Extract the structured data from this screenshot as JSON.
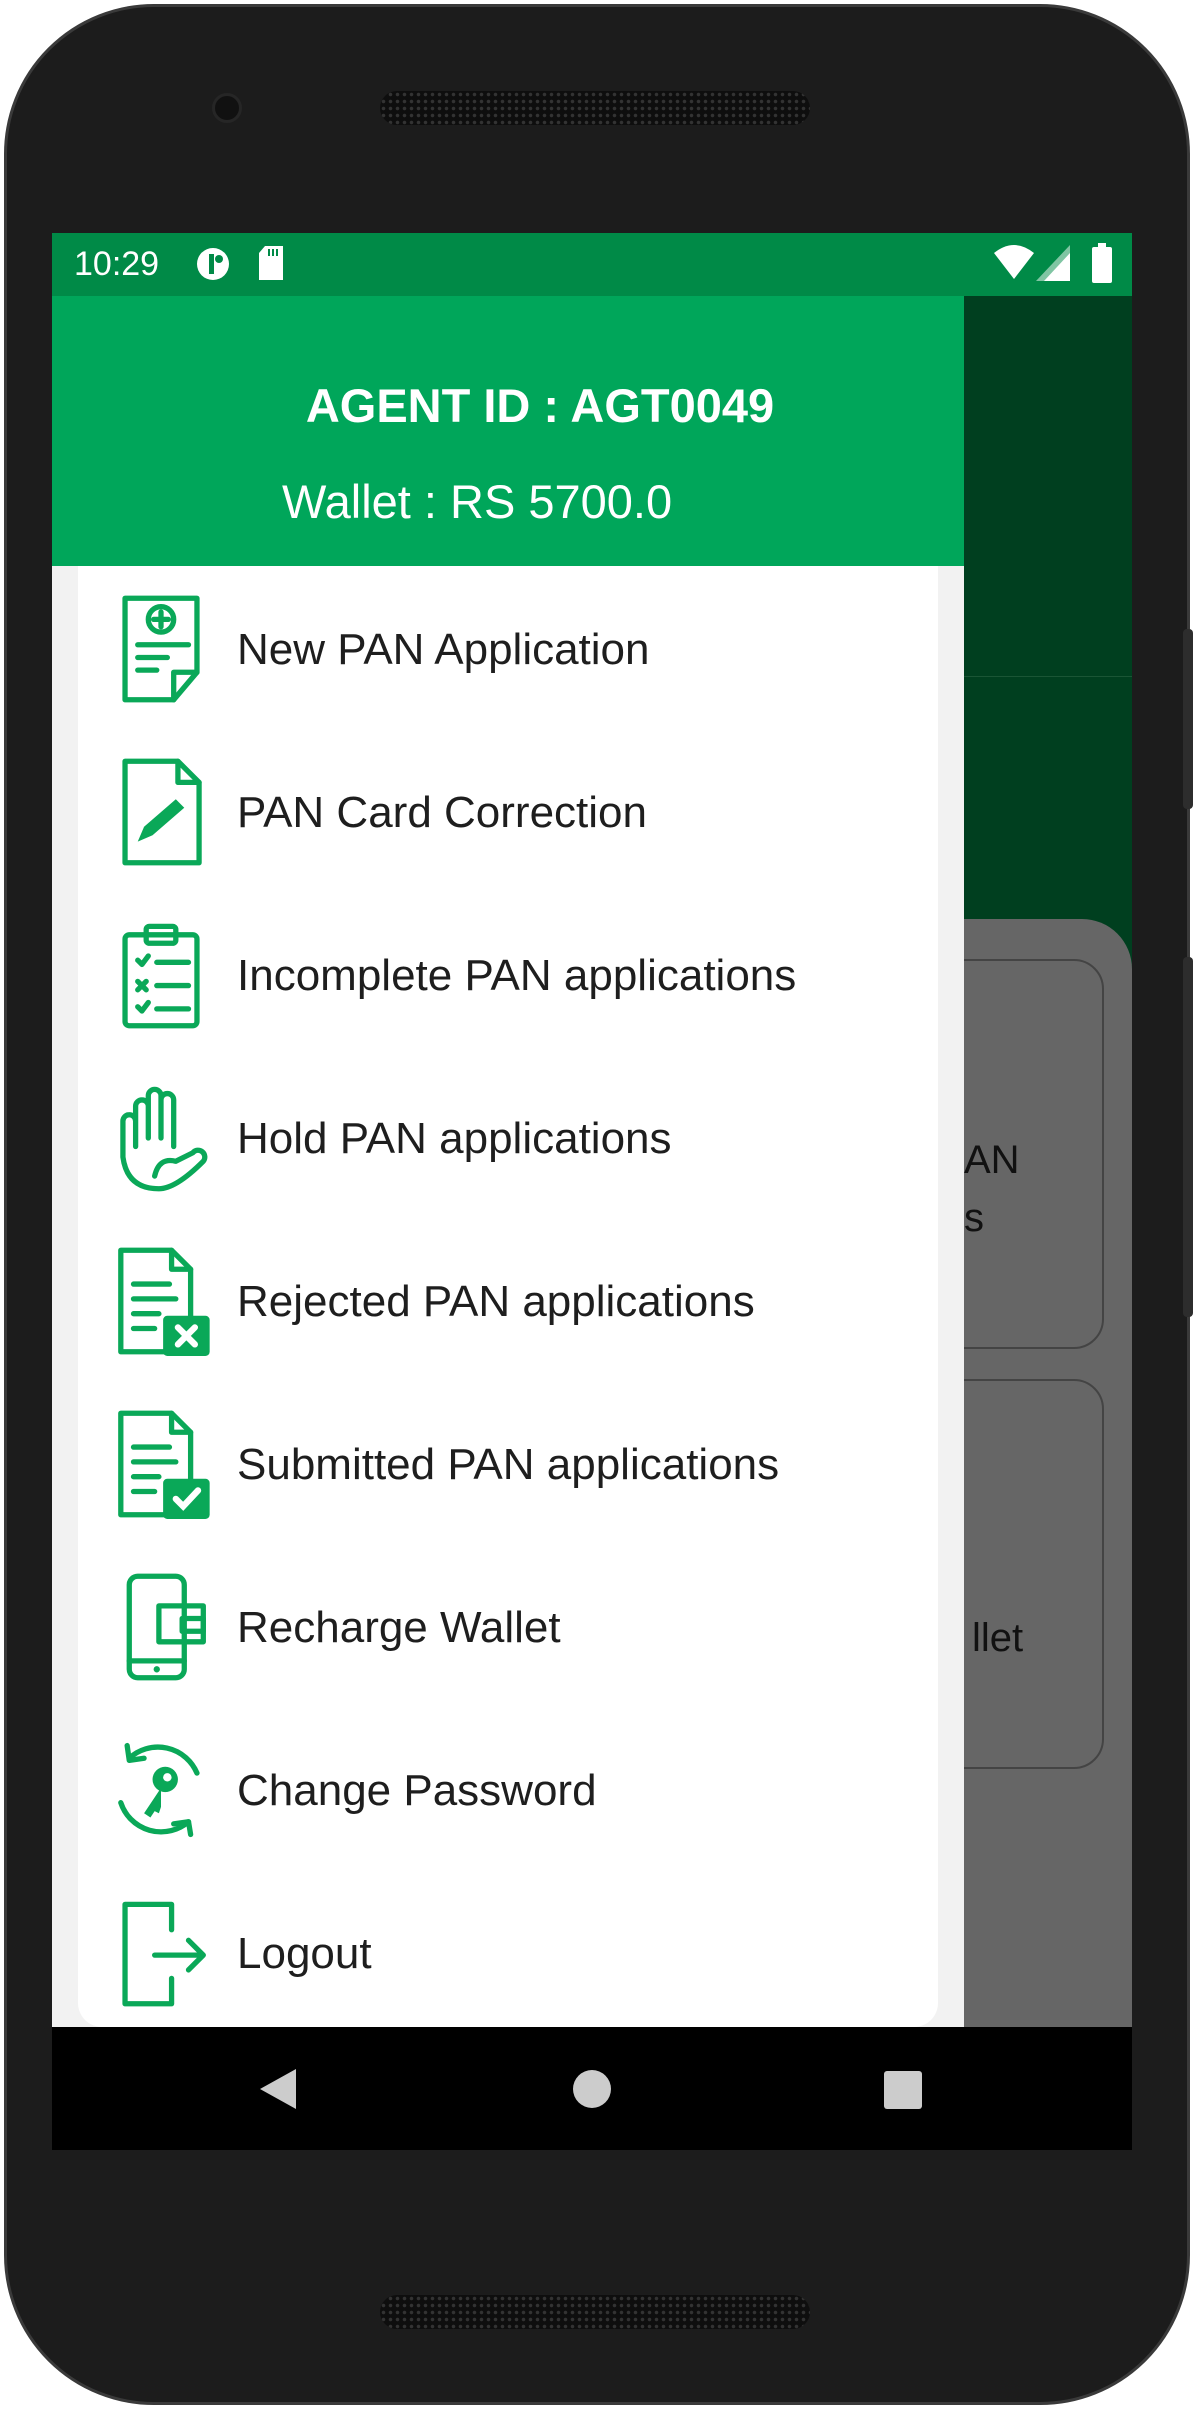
{
  "status_bar": {
    "time": "10:29",
    "icons": [
      "data-saver-icon",
      "sd-card-icon",
      "wifi-icon",
      "signal-icon",
      "battery-icon"
    ]
  },
  "drawer": {
    "agent_id": "AGENT ID : AGT0049",
    "wallet": "Wallet : RS 5700.0",
    "items": [
      {
        "label": "New PAN Application",
        "icon": "new-document-icon"
      },
      {
        "label": "PAN Card Correction",
        "icon": "edit-document-icon"
      },
      {
        "label": "Incomplete PAN applications",
        "icon": "checklist-icon"
      },
      {
        "label": "Hold PAN applications",
        "icon": "hand-icon"
      },
      {
        "label": "Rejected PAN applications",
        "icon": "rejected-document-icon"
      },
      {
        "label": "Submitted PAN applications",
        "icon": "submitted-document-icon"
      },
      {
        "label": "Recharge Wallet",
        "icon": "mobile-wallet-icon"
      },
      {
        "label": "Change Password",
        "icon": "key-refresh-icon"
      },
      {
        "label": "Logout",
        "icon": "logout-icon"
      }
    ]
  },
  "background": {
    "card1_text_line1": "AN",
    "card1_text_line2": "s",
    "card2_text": "llet"
  },
  "colors": {
    "primary": "#00a65a",
    "status_bar": "#008a47",
    "icon": "#0aa858"
  }
}
